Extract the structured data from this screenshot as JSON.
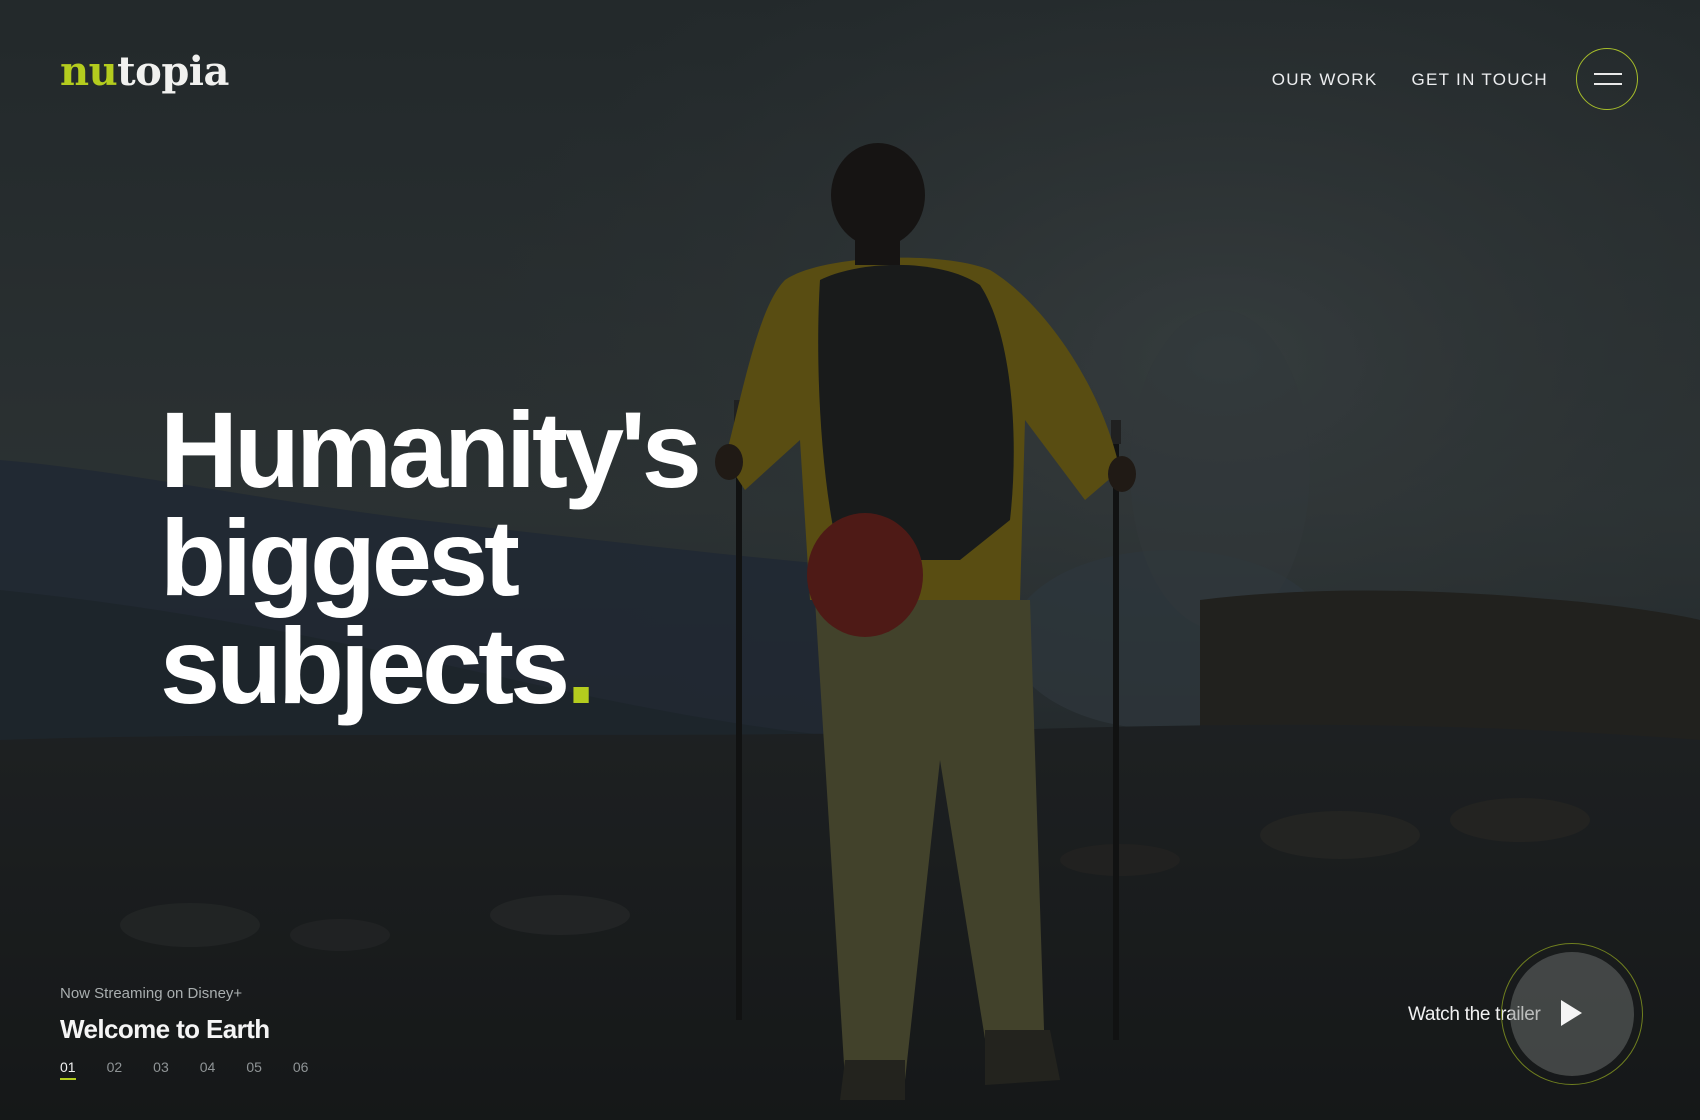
{
  "brand": {
    "logo_accent": "nu",
    "logo_rest": "topia",
    "accent_color": "#b4cc1e"
  },
  "nav": {
    "items": [
      "OUR WORK",
      "GET IN TOUCH"
    ],
    "menu_icon": "hamburger-menu-icon"
  },
  "hero": {
    "headline_lines": [
      "Humanity's",
      "biggest",
      "subjects"
    ],
    "headline_dot": "."
  },
  "feature": {
    "streaming_label": "Now Streaming on Disney+",
    "title": "Welcome to Earth",
    "pages": [
      "01",
      "02",
      "03",
      "04",
      "05",
      "06"
    ],
    "active_page": "01"
  },
  "trailer": {
    "label": "Watch the trailer",
    "icon": "play-icon"
  }
}
